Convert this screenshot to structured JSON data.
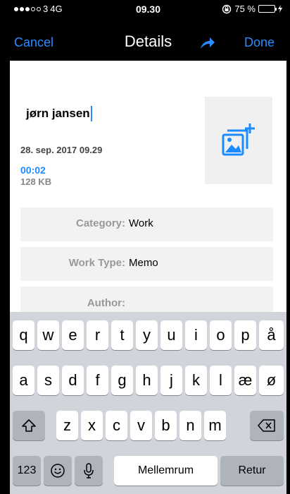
{
  "status_bar": {
    "carrier": "3",
    "network": "4G",
    "time": "09.30",
    "battery_text": "75 %",
    "signal_icon": "signal-dots-icon",
    "rotation_icon": "rotation-lock-icon",
    "battery_icon": "battery-icon",
    "battery_level": 0.75
  },
  "nav": {
    "cancel_label": "Cancel",
    "title": "Details",
    "share_icon": "share-arrow-icon",
    "done_label": "Done"
  },
  "recording": {
    "name": "jørn jansen",
    "date": "28. sep. 2017 09.29",
    "duration": "00:02",
    "size": "128 KB",
    "add_photo_icon": "add-photo-icon"
  },
  "fields": [
    {
      "label": "Category:",
      "value": "Work"
    },
    {
      "label": "Work Type:",
      "value": "Memo"
    },
    {
      "label": "Author:",
      "value": ""
    }
  ],
  "keyboard": {
    "row1": [
      "q",
      "w",
      "e",
      "r",
      "t",
      "y",
      "u",
      "i",
      "o",
      "p",
      "å"
    ],
    "row2": [
      "a",
      "s",
      "d",
      "f",
      "g",
      "h",
      "j",
      "k",
      "l",
      "æ",
      "ø"
    ],
    "row3": [
      "z",
      "x",
      "c",
      "v",
      "b",
      "n",
      "m"
    ],
    "numbers_label": "123",
    "space_label": "Mellemrum",
    "return_label": "Retur",
    "shift_icon": "shift-icon",
    "backspace_icon": "backspace-icon",
    "emoji_icon": "emoji-icon",
    "mic_icon": "microphone-icon"
  },
  "colors": {
    "accent": "#2a8cff",
    "battery": "#4cd964"
  }
}
